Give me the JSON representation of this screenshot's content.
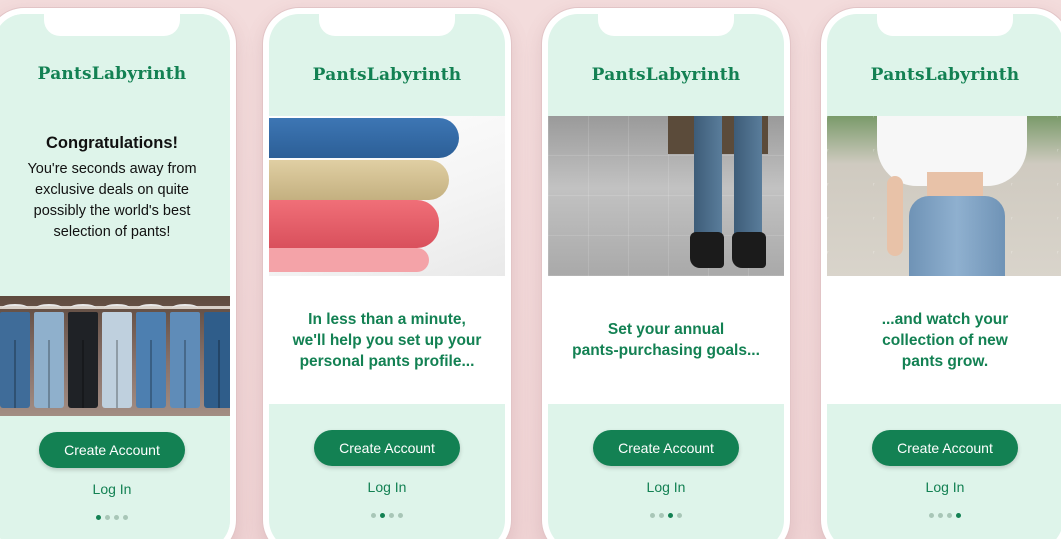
{
  "brand": "PantsLabyrinth",
  "colors": {
    "accent": "#138153",
    "mint": "#def4ea",
    "background": "#f3dcdc"
  },
  "common": {
    "create_account_label": "Create Account",
    "log_in_label": "Log In"
  },
  "screens": [
    {
      "title": "Congratulations!",
      "body": "You're seconds away from\nexclusive deals on quite\npossibly the world's best\nselection of pants!",
      "image": "jeans-on-rack-photo",
      "active_dot": 0
    },
    {
      "caption": "In less than a minute,\nwe'll help you set up your\npersonal pants profile...",
      "image": "folded-pants-stack-photo",
      "active_dot": 1
    },
    {
      "caption": "Set your annual\npants-purchasing goals...",
      "image": "jeans-and-boots-photo",
      "active_dot": 2
    },
    {
      "caption": "...and watch your\ncollection of new\npants grow.",
      "image": "model-in-jeans-photo",
      "active_dot": 3
    }
  ]
}
